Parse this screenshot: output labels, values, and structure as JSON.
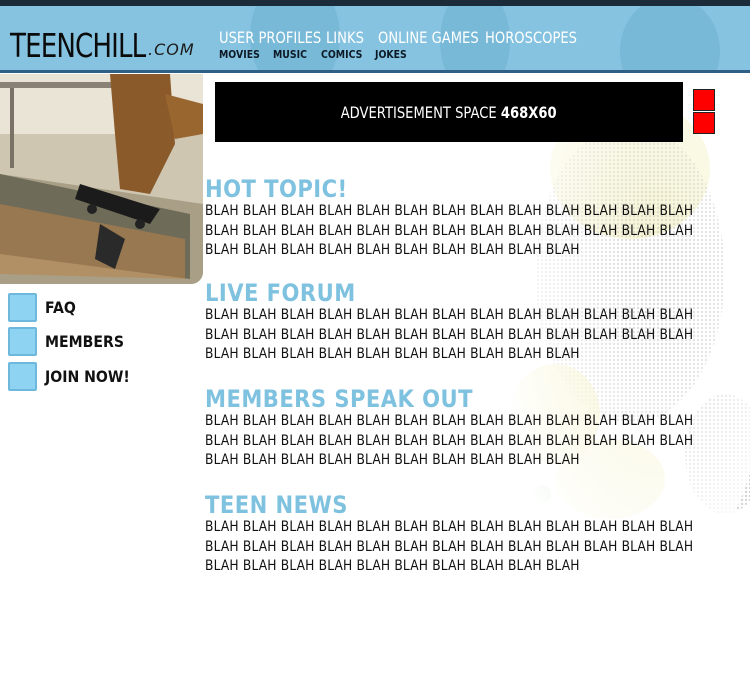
{
  "brand": {
    "name": "TEENCHILL",
    "domain": ".COM"
  },
  "nav": {
    "main": [
      "USER PROFILES",
      "LINKS",
      "ONLINE GAMES",
      "HOROSCOPES"
    ],
    "sub": [
      "MOVIES",
      "MUSIC",
      "COMICS",
      "JOKES"
    ]
  },
  "sidebar": {
    "items": [
      {
        "label": "FAQ"
      },
      {
        "label": "MEMBERS"
      },
      {
        "label": "JOIN NOW!"
      }
    ]
  },
  "ad": {
    "label": "ADVERTISEMENT SPACE",
    "size": "468X60"
  },
  "sections": [
    {
      "title": "HOT TOPIC!",
      "body": "BLAH BLAH BLAH BLAH BLAH BLAH BLAH BLAH BLAH BLAH BLAH BLAH BLAH BLAH BLAH BLAH BLAH BLAH BLAH BLAH BLAH BLAH BLAH BLAH BLAH BLAH BLAH BLAH BLAH BLAH BLAH BLAH BLAH BLAH BLAH BLAH"
    },
    {
      "title": "LIVE FORUM",
      "body": "BLAH BLAH BLAH BLAH BLAH BLAH BLAH BLAH BLAH BLAH BLAH BLAH BLAH BLAH BLAH BLAH BLAH BLAH BLAH BLAH BLAH BLAH BLAH BLAH BLAH BLAH BLAH BLAH BLAH BLAH BLAH BLAH BLAH BLAH BLAH BLAH"
    },
    {
      "title": "MEMBERS SPEAK OUT",
      "body": "BLAH BLAH BLAH BLAH BLAH BLAH BLAH BLAH BLAH BLAH BLAH BLAH BLAH BLAH BLAH BLAH BLAH BLAH BLAH BLAH BLAH BLAH BLAH BLAH BLAH BLAH BLAH BLAH BLAH BLAH BLAH BLAH BLAH BLAH BLAH BLAH"
    },
    {
      "title": "TEEN NEWS",
      "body": "BLAH BLAH BLAH BLAH BLAH BLAH BLAH BLAH BLAH BLAH BLAH BLAH BLAH BLAH BLAH BLAH BLAH BLAH BLAH BLAH BLAH BLAH BLAH BLAH BLAH BLAH BLAH BLAH BLAH BLAH BLAH BLAH BLAH BLAH BLAH BLAH"
    }
  ],
  "colors": {
    "header": "#86c3e0",
    "accent": "#7ec2e0",
    "sidebar_box": "#8fd3f3",
    "ad_bg": "#000000",
    "close_button": "#ff0000"
  }
}
